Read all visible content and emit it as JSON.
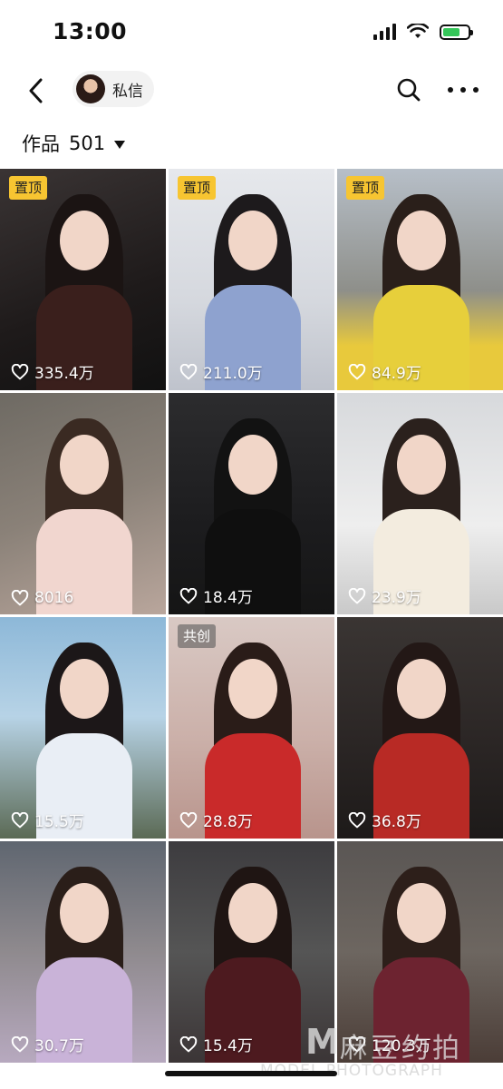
{
  "status_bar": {
    "time": "13:00"
  },
  "nav": {
    "dm_label": "私信"
  },
  "works": {
    "title": "作品",
    "count": "501"
  },
  "posts": [
    {
      "badge": "置顶",
      "badge_type": "pinned",
      "likes": "335.4万",
      "theme": "dark"
    },
    {
      "badge": "置顶",
      "badge_type": "pinned",
      "likes": "211.0万",
      "theme": "sweater"
    },
    {
      "badge": "置顶",
      "badge_type": "pinned",
      "likes": "84.9万",
      "theme": "yellow"
    },
    {
      "badge": "",
      "badge_type": "",
      "likes": "8016",
      "theme": "pink"
    },
    {
      "badge": "",
      "badge_type": "",
      "likes": "18.4万",
      "theme": "rain"
    },
    {
      "badge": "",
      "badge_type": "",
      "likes": "23.9万",
      "theme": "white"
    },
    {
      "badge": "",
      "badge_type": "",
      "likes": "15.5万",
      "theme": "sky"
    },
    {
      "badge": "共创",
      "badge_type": "collab",
      "likes": "28.8万",
      "theme": "red"
    },
    {
      "badge": "",
      "badge_type": "",
      "likes": "36.8万",
      "theme": "spider"
    },
    {
      "badge": "",
      "badge_type": "",
      "likes": "30.7万",
      "theme": "lilac"
    },
    {
      "badge": "",
      "badge_type": "",
      "likes": "15.4万",
      "theme": "warrior"
    },
    {
      "badge": "",
      "badge_type": "",
      "likes": "120.3万",
      "theme": "warrior2"
    }
  ],
  "watermark": {
    "logo_text": "M",
    "cn": "麻豆约拍",
    "en": "MODEL PHOTOGRAPH"
  },
  "colors": {
    "pinned_badge": "#f7c531",
    "background": "#ffffff"
  },
  "icons": [
    "back-chevron-icon",
    "search-icon",
    "more-dots-icon",
    "heart-icon",
    "caret-down-icon",
    "signal-icon",
    "wifi-icon",
    "battery-icon"
  ]
}
